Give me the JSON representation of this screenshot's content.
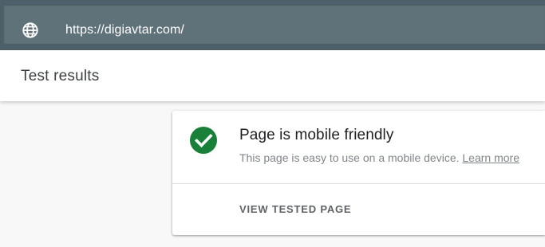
{
  "address_bar": {
    "url": "https://digiavtar.com/",
    "icon": "globe-icon"
  },
  "header": {
    "title": "Test results"
  },
  "result": {
    "title": "Page is mobile friendly",
    "description": "This page is easy to use on a mobile device.",
    "learn_more_label": "Learn more",
    "status_icon": "check-circle-icon",
    "status_color": "#188038",
    "action_label": "VIEW TESTED PAGE"
  },
  "colors": {
    "top_bar": "#4d5f69",
    "url_field": "#607279",
    "page_background": "#f8f8f8"
  }
}
